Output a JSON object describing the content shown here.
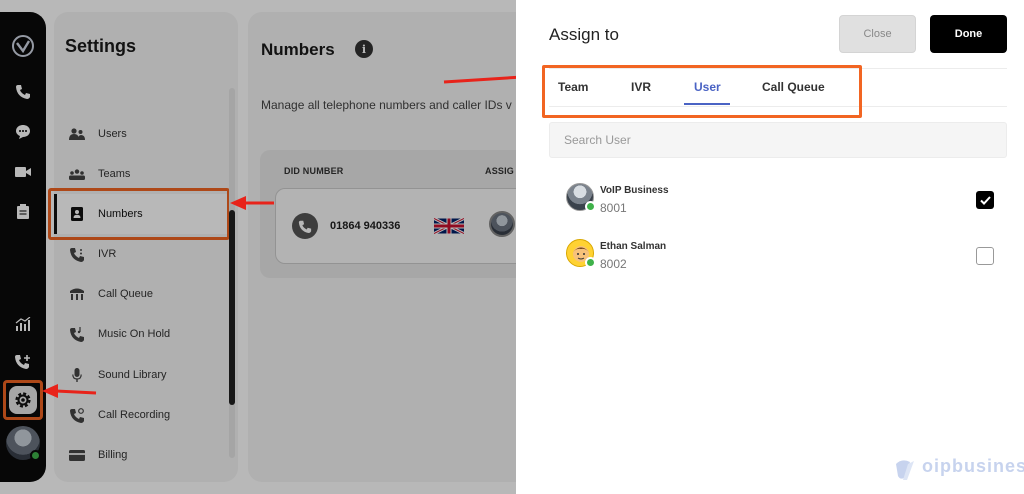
{
  "settings": {
    "title": "Settings",
    "menu": [
      {
        "label": "Users",
        "icon": "users-icon"
      },
      {
        "label": "Teams",
        "icon": "teams-icon"
      },
      {
        "label": "Numbers",
        "icon": "numbers-icon",
        "active": true
      },
      {
        "label": "IVR",
        "icon": "ivr-icon"
      },
      {
        "label": "Call Queue",
        "icon": "call-queue-icon"
      },
      {
        "label": "Music On Hold",
        "icon": "music-on-hold-icon"
      },
      {
        "label": "Sound Library",
        "icon": "microphone-icon"
      },
      {
        "label": "Call Recording",
        "icon": "call-recording-icon"
      },
      {
        "label": "Billing",
        "icon": "billing-icon"
      }
    ]
  },
  "numbers": {
    "title": "Numbers",
    "description": "Manage all telephone numbers and caller IDs v",
    "columns": [
      "DID NUMBER",
      "ASSIG"
    ],
    "rows": [
      {
        "did": "01864 940336",
        "country_flag": "uk-flag"
      }
    ]
  },
  "assign": {
    "title": "Assign to",
    "close_label": "Close",
    "done_label": "Done",
    "tabs": [
      "Team",
      "IVR",
      "User",
      "Call Queue"
    ],
    "active_tab": "User",
    "search_placeholder": "Search User",
    "users": [
      {
        "name": "VoIP Business",
        "ext": "8001",
        "checked": true
      },
      {
        "name": "Ethan Salman",
        "ext": "8002",
        "checked": false
      }
    ]
  },
  "watermark": "oipbusiness",
  "colors": {
    "accent": "#4a63c4",
    "highlight": "#f26522",
    "arrow": "#e8231a",
    "online": "#3fb24a"
  }
}
